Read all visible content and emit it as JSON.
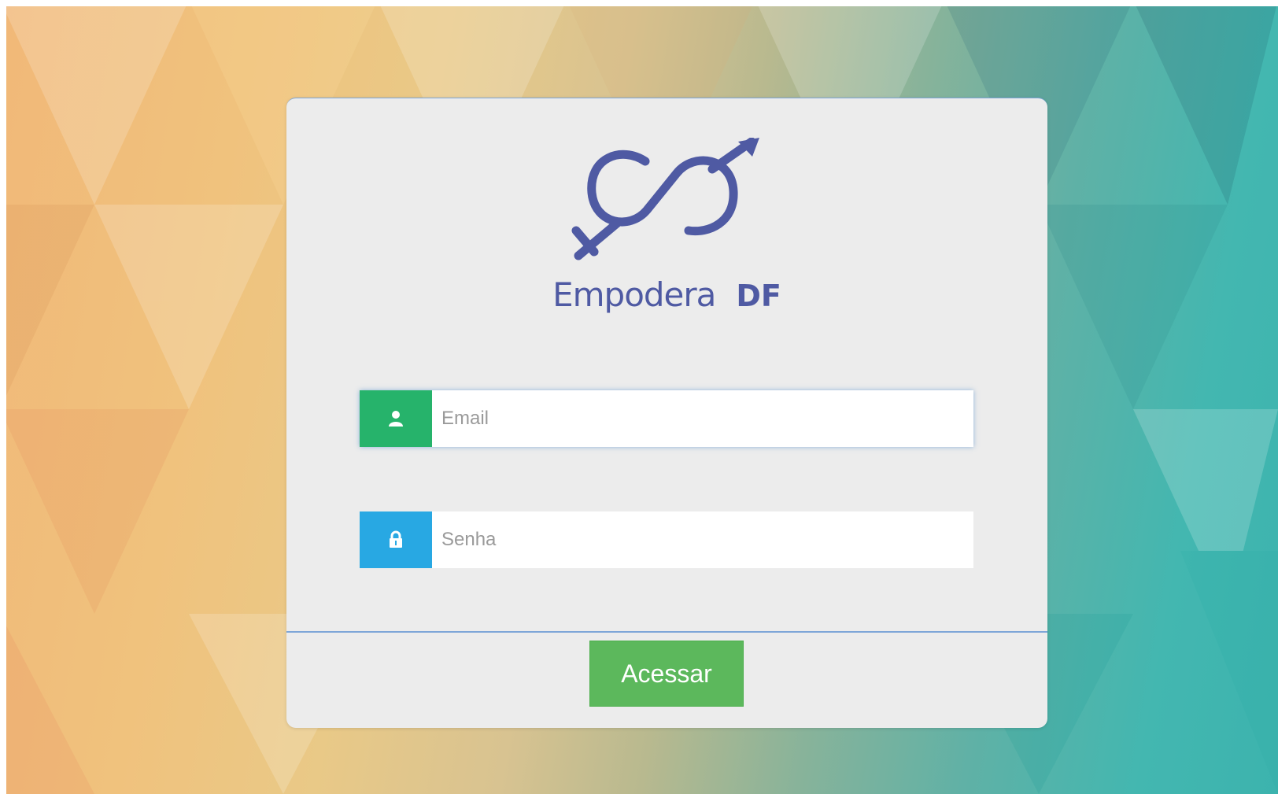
{
  "brand": {
    "name_part1": "Empodera",
    "name_part2": "DF",
    "logo_icon": "infinity-gender-symbol-icon",
    "color": "#4f5aa3"
  },
  "form": {
    "email": {
      "placeholder": "Email",
      "value": "",
      "icon": "user-icon",
      "icon_bg": "#26b36b"
    },
    "password": {
      "placeholder": "Senha",
      "value": "",
      "icon": "lock-icon",
      "icon_bg": "#28a8e3"
    },
    "submit_label": "Acessar",
    "submit_color": "#5cb85c"
  }
}
